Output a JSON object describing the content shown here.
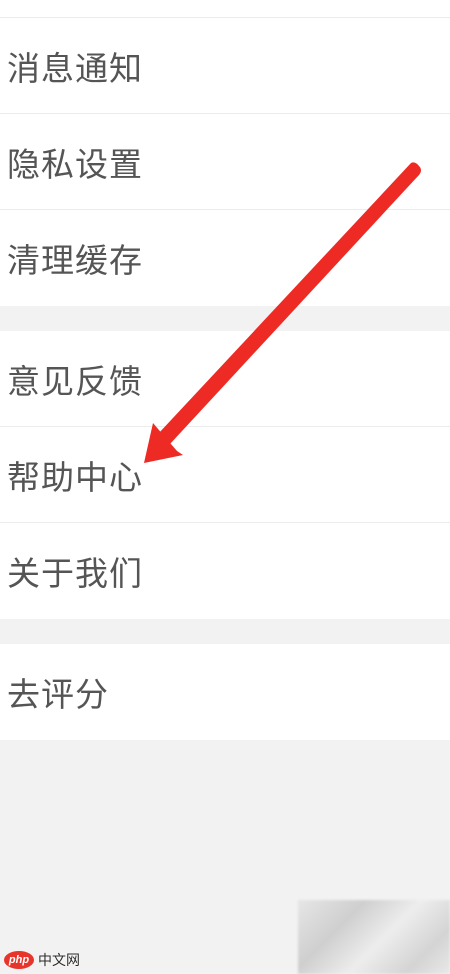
{
  "settings": {
    "group1": [
      {
        "label": "消息通知"
      },
      {
        "label": "隐私设置"
      },
      {
        "label": "清理缓存"
      }
    ],
    "group2": [
      {
        "label": "意见反馈"
      },
      {
        "label": "帮助中心"
      },
      {
        "label": "关于我们"
      }
    ],
    "group3": [
      {
        "label": "去评分"
      }
    ]
  },
  "annotation": {
    "arrow_color": "#ee2a24",
    "points_to": "帮助中心"
  },
  "watermark": {
    "badge": "php",
    "text": "中文网"
  },
  "colors": {
    "background": "#f2f2f2",
    "row_background": "#ffffff",
    "text": "#555555",
    "divider": "#ececec"
  }
}
